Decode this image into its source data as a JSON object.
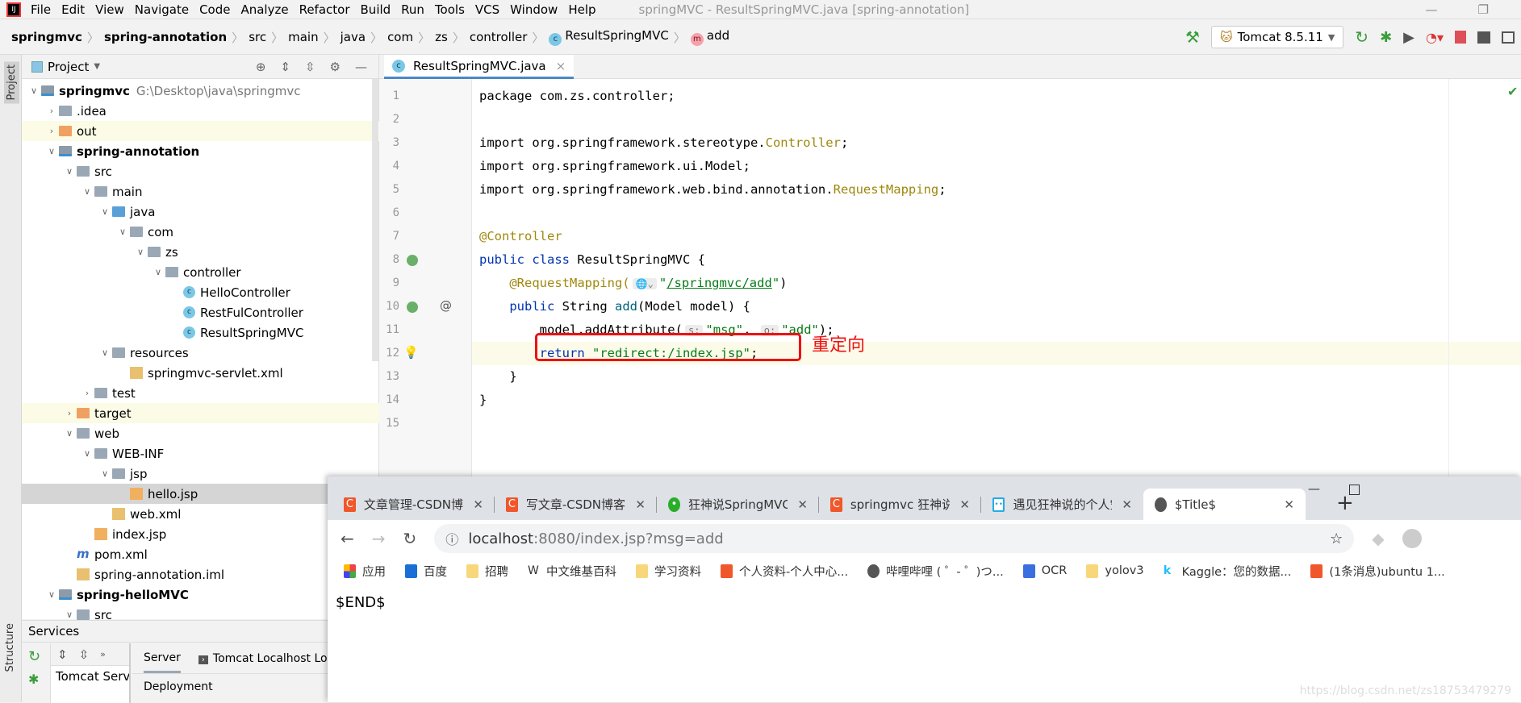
{
  "menubar": {
    "items": [
      "File",
      "Edit",
      "View",
      "Navigate",
      "Code",
      "Analyze",
      "Refactor",
      "Build",
      "Run",
      "Tools",
      "VCS",
      "Window",
      "Help"
    ],
    "title": "springMVC - ResultSpringMVC.java [spring-annotation]"
  },
  "breadcrumb": [
    "springmvc",
    "spring-annotation",
    "src",
    "main",
    "java",
    "com",
    "zs",
    "controller",
    "ResultSpringMVC",
    "add"
  ],
  "run_config": "Tomcat 8.5.11",
  "left_strip": {
    "project": "Project",
    "structure": "Structure"
  },
  "project": {
    "title": "Project",
    "tree": [
      {
        "label": "springmvc",
        "path": "G:\\Desktop\\java\\springmvc",
        "depth": 0,
        "expanded": true,
        "icon": "module-folder",
        "bold": true
      },
      {
        "label": ".idea",
        "depth": 1,
        "expanded": false,
        "icon": "folder"
      },
      {
        "label": "out",
        "depth": 1,
        "expanded": false,
        "icon": "orange-folder",
        "highlight": true
      },
      {
        "label": "spring-annotation",
        "depth": 1,
        "expanded": true,
        "icon": "module-folder",
        "bold": true
      },
      {
        "label": "src",
        "depth": 2,
        "expanded": true,
        "icon": "folder"
      },
      {
        "label": "main",
        "depth": 3,
        "expanded": true,
        "icon": "folder"
      },
      {
        "label": "java",
        "depth": 4,
        "expanded": true,
        "icon": "source-folder"
      },
      {
        "label": "com",
        "depth": 5,
        "expanded": true,
        "icon": "package"
      },
      {
        "label": "zs",
        "depth": 6,
        "expanded": true,
        "icon": "package"
      },
      {
        "label": "controller",
        "depth": 7,
        "expanded": true,
        "icon": "package"
      },
      {
        "label": "HelloController",
        "depth": 8,
        "icon": "class"
      },
      {
        "label": "RestFulController",
        "depth": 8,
        "icon": "class"
      },
      {
        "label": "ResultSpringMVC",
        "depth": 8,
        "icon": "class"
      },
      {
        "label": "resources",
        "depth": 4,
        "expanded": true,
        "icon": "resources-folder"
      },
      {
        "label": "springmvc-servlet.xml",
        "depth": 5,
        "icon": "xml-file"
      },
      {
        "label": "test",
        "depth": 3,
        "expanded": false,
        "icon": "folder"
      },
      {
        "label": "target",
        "depth": 2,
        "expanded": false,
        "icon": "orange-folder",
        "highlight": true
      },
      {
        "label": "web",
        "depth": 2,
        "expanded": true,
        "icon": "web-folder"
      },
      {
        "label": "WEB-INF",
        "depth": 3,
        "expanded": true,
        "icon": "folder"
      },
      {
        "label": "jsp",
        "depth": 4,
        "expanded": true,
        "icon": "folder"
      },
      {
        "label": "hello.jsp",
        "depth": 5,
        "icon": "jsp-file",
        "selected": true
      },
      {
        "label": "web.xml",
        "depth": 4,
        "icon": "xml-file"
      },
      {
        "label": "index.jsp",
        "depth": 3,
        "icon": "jsp-file"
      },
      {
        "label": "pom.xml",
        "depth": 2,
        "icon": "maven-file"
      },
      {
        "label": "spring-annotation.iml",
        "depth": 2,
        "icon": "iml-file"
      },
      {
        "label": "spring-helloMVC",
        "depth": 1,
        "expanded": true,
        "icon": "module-folder",
        "bold": true
      },
      {
        "label": "src",
        "depth": 2,
        "expanded": true,
        "icon": "folder"
      }
    ]
  },
  "editor": {
    "tab": "ResultSpringMVC.java",
    "current_line": 12,
    "lines": [
      [
        {
          "t": "package com.zs.controller;",
          "k": "t"
        }
      ],
      [],
      [
        {
          "t": "import org.springframework.stereotype.",
          "k": "t"
        },
        {
          "t": "Controller",
          "k": "a"
        },
        {
          "t": ";",
          "k": "t"
        }
      ],
      [
        {
          "t": "import org.springframework.ui.Model;",
          "k": "t"
        }
      ],
      [
        {
          "t": "import org.springframework.web.bind.annotation.",
          "k": "t"
        },
        {
          "t": "RequestMapping",
          "k": "a"
        },
        {
          "t": ";",
          "k": "t"
        }
      ],
      [],
      [
        {
          "t": "@Controller",
          "k": "a"
        }
      ],
      [
        {
          "t": "public class ",
          "k": "k"
        },
        {
          "t": "ResultSpringMVC {",
          "k": "t"
        }
      ],
      [
        {
          "t": "    @RequestMapping(",
          "k": "a"
        },
        {
          "t": "🌐⌄",
          "k": "hint"
        },
        {
          "t": "\"",
          "k": "s"
        },
        {
          "t": "/springmvc/add",
          "k": "u"
        },
        {
          "t": "\"",
          "k": "s"
        },
        {
          "t": ")",
          "k": "t"
        }
      ],
      [
        {
          "t": "    public ",
          "k": "k"
        },
        {
          "t": "String ",
          "k": "t"
        },
        {
          "t": "add",
          "k": "f"
        },
        {
          "t": "(Model model) {",
          "k": "t"
        }
      ],
      [
        {
          "t": "        model.addAttribute(",
          "k": "t"
        },
        {
          "t": "s:",
          "k": "hint"
        },
        {
          "t": "\"msg\"",
          "k": "s"
        },
        {
          "t": ", ",
          "k": "t"
        },
        {
          "t": "o:",
          "k": "hint"
        },
        {
          "t": "\"add\"",
          "k": "s"
        },
        {
          "t": ");",
          "k": "t"
        }
      ],
      [
        {
          "t": "        return ",
          "k": "k"
        },
        {
          "t": "\"redirect:/index.jsp\"",
          "k": "s"
        },
        {
          "t": ";",
          "k": "t"
        }
      ],
      [
        {
          "t": "    }",
          "k": "t"
        }
      ],
      [
        {
          "t": "}",
          "k": "t"
        }
      ],
      []
    ],
    "annotation": "重定向"
  },
  "services": {
    "title": "Services",
    "tabs": [
      "Server",
      "Tomcat Localhost Log"
    ],
    "tree_item": "Tomcat Server",
    "deployment": "Deployment"
  },
  "browser": {
    "tabs": [
      {
        "label": "文章管理-CSDN博客",
        "icon": "csdn"
      },
      {
        "label": "写文章-CSDN博客",
        "icon": "csdn"
      },
      {
        "label": "狂神说SpringMVC",
        "icon": "wechat"
      },
      {
        "label": "springmvc 狂神说",
        "icon": "csdn"
      },
      {
        "label": "遇见狂神说的个人空间",
        "icon": "bilibili"
      },
      {
        "label": "$Title$",
        "icon": "globe",
        "active": true
      }
    ],
    "url_host": "localhost",
    "url_rest": ":8080/index.jsp?msg=add",
    "bookmarks": [
      {
        "label": "应用",
        "icon": "apps"
      },
      {
        "label": "百度",
        "icon": "baidu"
      },
      {
        "label": "招聘",
        "icon": "folder"
      },
      {
        "label": "中文维基百科",
        "icon": "wikipedia"
      },
      {
        "label": "学习资料",
        "icon": "folder"
      },
      {
        "label": "个人资料-个人中心...",
        "icon": "csdn"
      },
      {
        "label": "哔哩哔哩 ( ゜- ゜)つ...",
        "icon": "globe"
      },
      {
        "label": "OCR",
        "icon": "ocr"
      },
      {
        "label": "yolov3",
        "icon": "folder"
      },
      {
        "label": "Kaggle：您的数据...",
        "icon": "kaggle"
      },
      {
        "label": "(1条消息)ubuntu 1...",
        "icon": "csdn"
      }
    ],
    "content": "$END$"
  },
  "watermark": "https://blog.csdn.net/zs18753479279"
}
